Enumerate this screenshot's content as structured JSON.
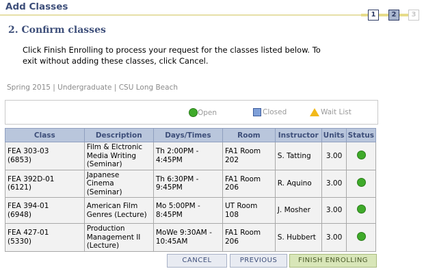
{
  "header": {
    "title": "Add Classes",
    "subtitle": "2.  Confirm classes",
    "steps": [
      "1",
      "2",
      "3"
    ]
  },
  "instructions": "Click Finish Enrolling to process your request for the classes listed below. To exit without adding these classes, click Cancel.",
  "term_info": "Spring 2015 | Undergraduate | CSU Long Beach",
  "legend": {
    "open": "Open",
    "closed": "Closed",
    "wait_list": "Wait List"
  },
  "table": {
    "headers": {
      "class": "Class",
      "description": "Description",
      "days_times": "Days/Times",
      "room": "Room",
      "instructor": "Instructor",
      "units": "Units",
      "status": "Status"
    },
    "rows": [
      {
        "class_code": "FEA 303-03",
        "class_num": "(6853)",
        "desc_1": "Film & Elctronic",
        "desc_2": "Media Writing",
        "desc_3": "(Seminar)",
        "times_1": "Th 2:00PM -",
        "times_2": "4:45PM",
        "room_1": "FA1  Room",
        "room_2": "202",
        "instructor": "S. Tatting",
        "units": "3.00",
        "status": "Open"
      },
      {
        "class_code": "FEA 392D-01",
        "class_num": "(6121)",
        "desc_1": "Japanese",
        "desc_2": "Cinema",
        "desc_3": "(Seminar)",
        "times_1": "Th 6:30PM -",
        "times_2": "9:45PM",
        "room_1": "FA1  Room",
        "room_2": "206",
        "instructor": "R. Aquino",
        "units": "3.00",
        "status": "Open"
      },
      {
        "class_code": "FEA 394-01",
        "class_num": "(6948)",
        "desc_1": "American Film",
        "desc_2": "Genres (Lecture)",
        "desc_3": "",
        "times_1": "Mo 5:00PM -",
        "times_2": "8:45PM",
        "room_1": "UT  Room",
        "room_2": "108",
        "instructor": "J. Mosher",
        "units": "3.00",
        "status": "Open"
      },
      {
        "class_code": "FEA 427-01",
        "class_num": "(5330)",
        "desc_1": "Production",
        "desc_2": "Management II",
        "desc_3": "(Lecture)",
        "times_1": "MoWe 9:30AM -",
        "times_2": "10:45AM",
        "room_1": "FA1  Room",
        "room_2": "206",
        "instructor": "S. Hubbert",
        "units": "3.00",
        "status": "Open"
      }
    ]
  },
  "buttons": {
    "cancel": "CANCEL",
    "previous": "PREVIOUS",
    "finish": "FINISH ENROLLING"
  },
  "colors": {
    "title": "#3e4f7a",
    "header_bg": "#b9c6dc",
    "open_green": "#3faa2a",
    "finish_bg": "#d8e6b8"
  }
}
